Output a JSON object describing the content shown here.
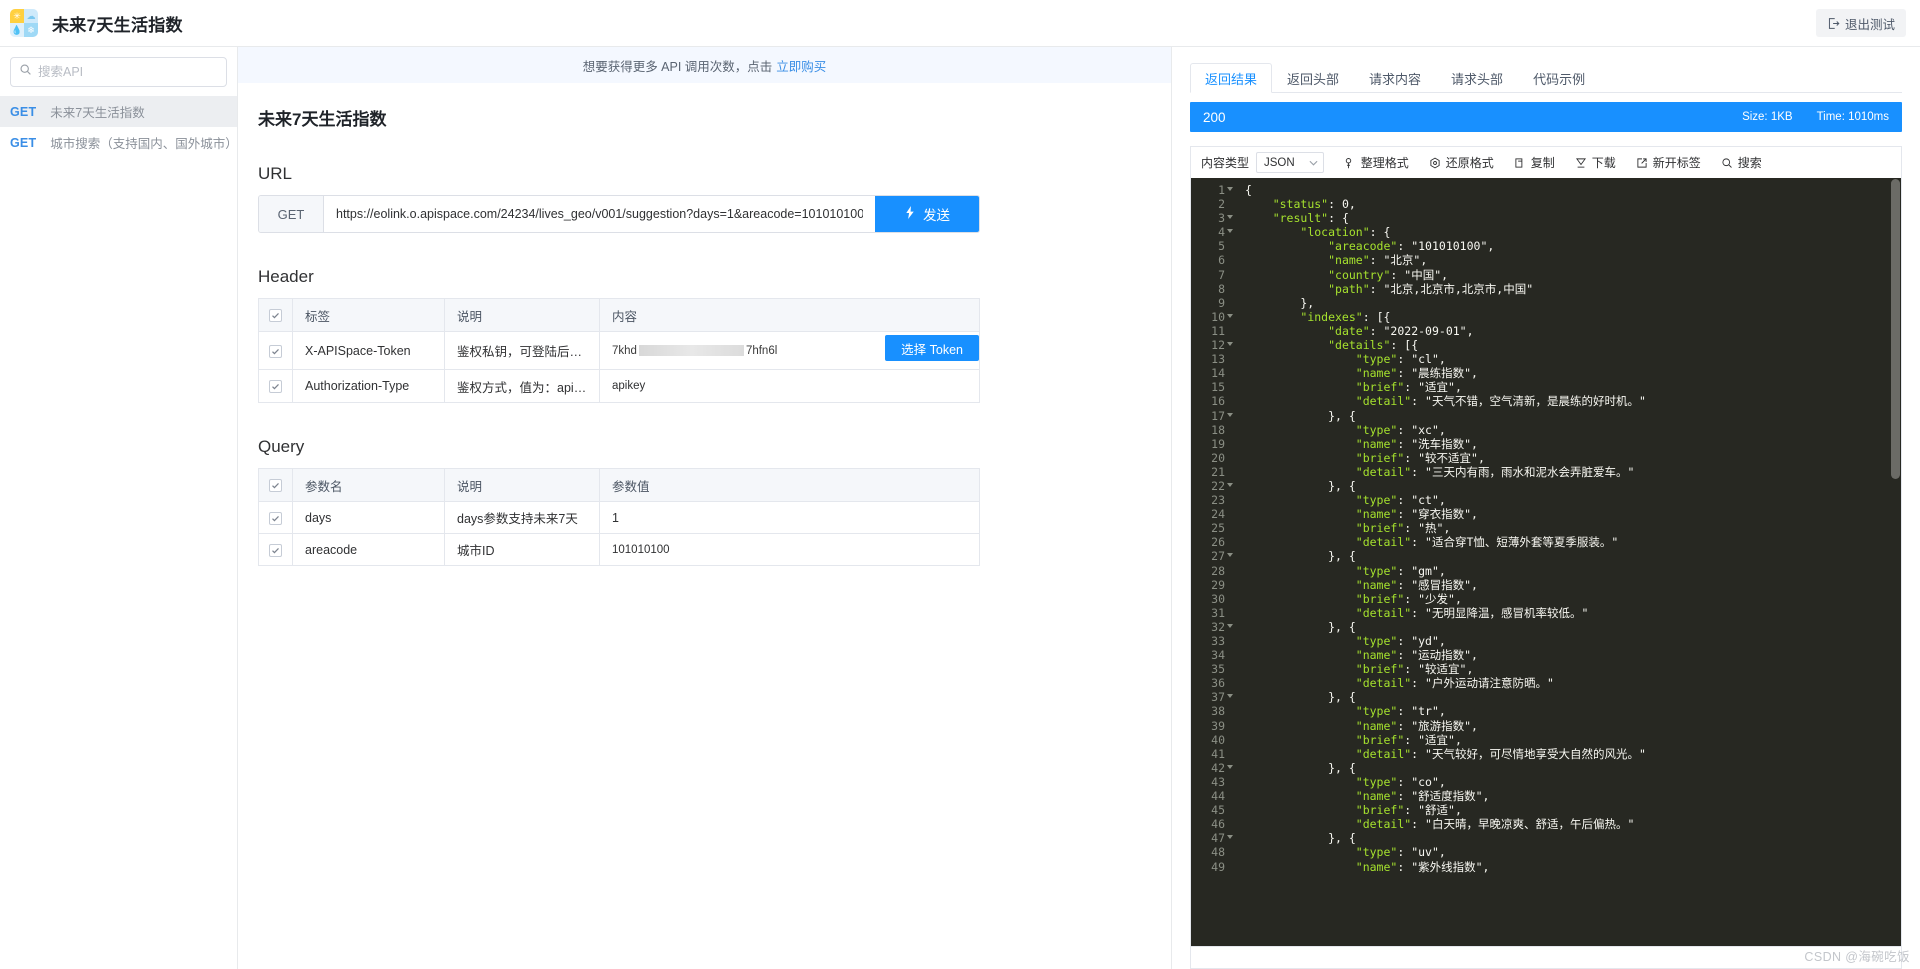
{
  "topbar": {
    "app_title": "未来7天生活指数",
    "logout_label": "退出测试",
    "logo_icon": "weather-grid-icon"
  },
  "sidebar": {
    "search": {
      "placeholder": "搜索API",
      "value": "",
      "icon": "search-icon"
    },
    "items": [
      {
        "method": "GET",
        "label": "未来7天生活指数",
        "active": true
      },
      {
        "method": "GET",
        "label": "城市搜索（支持国内、国外城市）",
        "active": false
      }
    ]
  },
  "notice": {
    "text": "想要获得更多 API 调用次数，点击",
    "link": "立即购买"
  },
  "main": {
    "doc_title": "未来7天生活指数",
    "url_section_title": "URL",
    "url": {
      "method": "GET",
      "value": "https://eolink.o.apispace.com/24234/lives_geo/v001/suggestion?days=1&areacode=101010100",
      "send_label": "发送",
      "send_icon": "lightning-icon"
    },
    "header_section": {
      "title": "Header",
      "columns": [
        "标签",
        "说明",
        "内容"
      ],
      "rows": [
        {
          "checked": true,
          "name": "X-APISpace-Token",
          "desc": "鉴权私钥，可登陆后在管…",
          "value_prefix": "7khd",
          "value_masked": true,
          "value_suffix": "7hfn6l",
          "action_label": "选择 Token"
        },
        {
          "checked": true,
          "name": "Authorization-Type",
          "desc": "鉴权方式，值为：apikey",
          "value_prefix": "apikey",
          "value_masked": false,
          "value_suffix": "",
          "action_label": ""
        }
      ]
    },
    "query_section": {
      "title": "Query",
      "columns": [
        "参数名",
        "说明",
        "参数值"
      ],
      "rows": [
        {
          "checked": true,
          "name": "days",
          "desc": "days参数支持未来7天",
          "value": "1"
        },
        {
          "checked": true,
          "name": "areacode",
          "desc": "城市ID",
          "value": "101010100"
        }
      ]
    }
  },
  "response": {
    "tabs": [
      {
        "label": "返回结果",
        "active": true
      },
      {
        "label": "返回头部",
        "active": false
      },
      {
        "label": "请求内容",
        "active": false
      },
      {
        "label": "请求头部",
        "active": false
      },
      {
        "label": "代码示例",
        "active": false
      }
    ],
    "status": {
      "code": "200",
      "size": "Size: 1KB",
      "time": "Time: 1010ms"
    },
    "toolbar": {
      "content_type_label": "内容类型",
      "content_type_value": "JSON",
      "buttons": [
        {
          "label": "整理格式",
          "icon": "format-icon"
        },
        {
          "label": "还原格式",
          "icon": "restore-icon"
        },
        {
          "label": "复制",
          "icon": "copy-icon"
        },
        {
          "label": "下载",
          "icon": "download-icon"
        },
        {
          "label": "新开标签",
          "icon": "new-tab-icon"
        },
        {
          "label": "搜索",
          "icon": "search-icon"
        }
      ]
    },
    "code_lines": [
      {
        "n": 1,
        "fold": true,
        "t": "{"
      },
      {
        "n": 2,
        "fold": false,
        "t": "    \"status\": 0,"
      },
      {
        "n": 3,
        "fold": true,
        "t": "    \"result\": {"
      },
      {
        "n": 4,
        "fold": true,
        "t": "        \"location\": {"
      },
      {
        "n": 5,
        "fold": false,
        "t": "            \"areacode\": \"101010100\","
      },
      {
        "n": 6,
        "fold": false,
        "t": "            \"name\": \"北京\","
      },
      {
        "n": 7,
        "fold": false,
        "t": "            \"country\": \"中国\","
      },
      {
        "n": 8,
        "fold": false,
        "t": "            \"path\": \"北京,北京市,北京市,中国\""
      },
      {
        "n": 9,
        "fold": false,
        "t": "        },"
      },
      {
        "n": 10,
        "fold": true,
        "t": "        \"indexes\": [{"
      },
      {
        "n": 11,
        "fold": false,
        "t": "            \"date\": \"2022-09-01\","
      },
      {
        "n": 12,
        "fold": true,
        "t": "            \"details\": [{"
      },
      {
        "n": 13,
        "fold": false,
        "t": "                \"type\": \"cl\","
      },
      {
        "n": 14,
        "fold": false,
        "t": "                \"name\": \"晨练指数\","
      },
      {
        "n": 15,
        "fold": false,
        "t": "                \"brief\": \"适宜\","
      },
      {
        "n": 16,
        "fold": false,
        "t": "                \"detail\": \"天气不错，空气清新，是晨练的好时机。\""
      },
      {
        "n": 17,
        "fold": true,
        "t": "            }, {"
      },
      {
        "n": 18,
        "fold": false,
        "t": "                \"type\": \"xc\","
      },
      {
        "n": 19,
        "fold": false,
        "t": "                \"name\": \"洗车指数\","
      },
      {
        "n": 20,
        "fold": false,
        "t": "                \"brief\": \"较不适宜\","
      },
      {
        "n": 21,
        "fold": false,
        "t": "                \"detail\": \"三天内有雨，雨水和泥水会弄脏爱车。\""
      },
      {
        "n": 22,
        "fold": true,
        "t": "            }, {"
      },
      {
        "n": 23,
        "fold": false,
        "t": "                \"type\": \"ct\","
      },
      {
        "n": 24,
        "fold": false,
        "t": "                \"name\": \"穿衣指数\","
      },
      {
        "n": 25,
        "fold": false,
        "t": "                \"brief\": \"热\","
      },
      {
        "n": 26,
        "fold": false,
        "t": "                \"detail\": \"适合穿T恤、短薄外套等夏季服装。\""
      },
      {
        "n": 27,
        "fold": true,
        "t": "            }, {"
      },
      {
        "n": 28,
        "fold": false,
        "t": "                \"type\": \"gm\","
      },
      {
        "n": 29,
        "fold": false,
        "t": "                \"name\": \"感冒指数\","
      },
      {
        "n": 30,
        "fold": false,
        "t": "                \"brief\": \"少发\","
      },
      {
        "n": 31,
        "fold": false,
        "t": "                \"detail\": \"无明显降温，感冒机率较低。\""
      },
      {
        "n": 32,
        "fold": true,
        "t": "            }, {"
      },
      {
        "n": 33,
        "fold": false,
        "t": "                \"type\": \"yd\","
      },
      {
        "n": 34,
        "fold": false,
        "t": "                \"name\": \"运动指数\","
      },
      {
        "n": 35,
        "fold": false,
        "t": "                \"brief\": \"较适宜\","
      },
      {
        "n": 36,
        "fold": false,
        "t": "                \"detail\": \"户外运动请注意防晒。\""
      },
      {
        "n": 37,
        "fold": true,
        "t": "            }, {"
      },
      {
        "n": 38,
        "fold": false,
        "t": "                \"type\": \"tr\","
      },
      {
        "n": 39,
        "fold": false,
        "t": "                \"name\": \"旅游指数\","
      },
      {
        "n": 40,
        "fold": false,
        "t": "                \"brief\": \"适宜\","
      },
      {
        "n": 41,
        "fold": false,
        "t": "                \"detail\": \"天气较好，可尽情地享受大自然的风光。\""
      },
      {
        "n": 42,
        "fold": true,
        "t": "            }, {"
      },
      {
        "n": 43,
        "fold": false,
        "t": "                \"type\": \"co\","
      },
      {
        "n": 44,
        "fold": false,
        "t": "                \"name\": \"舒适度指数\","
      },
      {
        "n": 45,
        "fold": false,
        "t": "                \"brief\": \"舒适\","
      },
      {
        "n": 46,
        "fold": false,
        "t": "                \"detail\": \"白天晴，早晚凉爽、舒适，午后偏热。\""
      },
      {
        "n": 47,
        "fold": true,
        "t": "            }, {"
      },
      {
        "n": 48,
        "fold": false,
        "t": "                \"type\": \"uv\","
      },
      {
        "n": 49,
        "fold": false,
        "t": "                \"name\": \"紫外线指数\","
      }
    ]
  },
  "watermark": "CSDN @海碗吃饭",
  "colors": {
    "accent": "#1890ff",
    "link": "#3a8ee6",
    "code_bg": "#272822",
    "code_string": "#e6db74",
    "code_key": "#a6e22e",
    "code_number": "#ae81ff"
  }
}
